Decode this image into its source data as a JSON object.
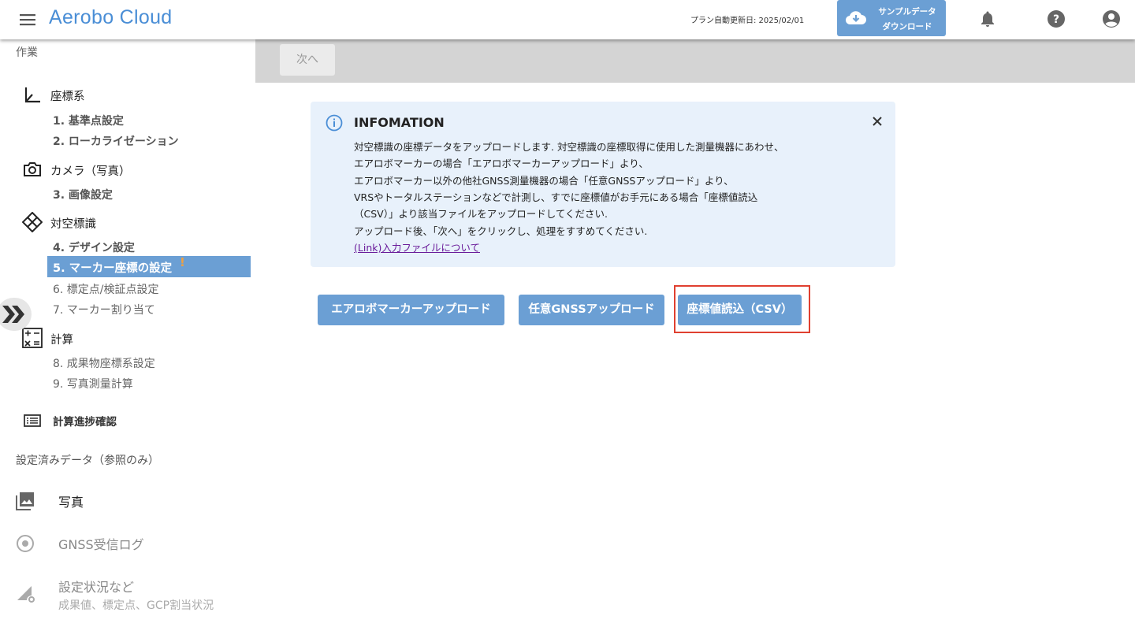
{
  "header": {
    "app_title": "Aerobo Cloud",
    "plan_update": "プラン自動更新日: 2025/02/01",
    "sample_line1": "サンプルデータ",
    "sample_line2": "ダウンロード",
    "icons": [
      "menu-icon",
      "cloud-download-icon",
      "bell-icon",
      "help-icon",
      "account-icon"
    ]
  },
  "sidebar": {
    "work_label": "作業",
    "sections": {
      "coordinate": "座標系",
      "camera": "カメラ（写真）",
      "gcp": "対空標識",
      "calc": "計算"
    },
    "steps": {
      "s1": "1. 基準点設定",
      "s2": "2. ローカライゼーション",
      "s3": "3. 画像設定",
      "s4": "4. デザイン設定",
      "s5": "5. マーカー座標の設定",
      "s5_warn": "!",
      "s6": "6. 標定点/検証点設定",
      "s7": "7. マーカー割り当て",
      "s8": "8. 成果物座標系設定",
      "s9": "9. 写真測量計算"
    },
    "progress": "計算進捗確認",
    "ref_header": "設定済みデータ（参照のみ）",
    "ref_items": {
      "photos": "写真",
      "gnss_log": "GNSS受信ログ",
      "status": "設定状況など",
      "status_sub": "成果値、標定点、GCP割当状況"
    }
  },
  "main": {
    "next_label": "次へ",
    "info": {
      "title": "INFOMATION",
      "lines": [
        "対空標識の座標データをアップロードします. 対空標識の座標取得に使用した測量機器にあわせ、",
        "エアロボマーカーの場合「エアロボマーカーアップロード」より、",
        "エアロボマーカー以外の他社GNSS測量機器の場合「任意GNSSアップロード」より、",
        "VRSやトータルステーションなどで計測し、すでに座標値がお手元にある場合「座標値読込",
        "（CSV）」より該当ファイルをアップロードしてください.",
        "アップロード後、「次へ」をクリックし、処理をすすめてください."
      ],
      "link": "(Link)入力ファイルについて"
    },
    "buttons": {
      "aerobo": "エアロボマーカーアップロード",
      "gnss": "任意GNSSアップロード",
      "csv": "座標値読込（CSV）"
    },
    "highlight_color": "#e04030",
    "accent_color": "#6b9fd4"
  }
}
